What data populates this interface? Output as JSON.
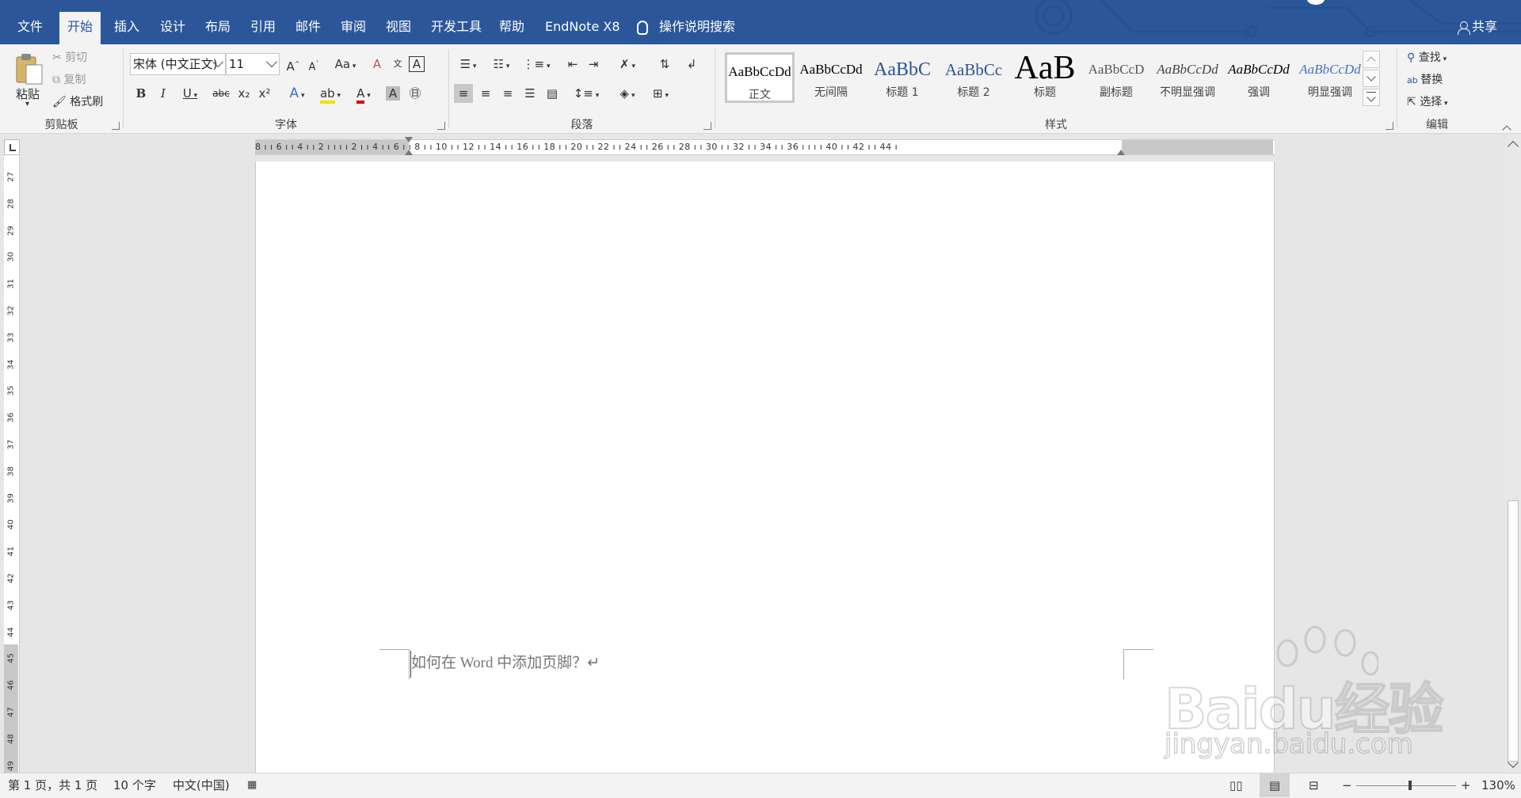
{
  "tabs": [
    "文件",
    "开始",
    "插入",
    "设计",
    "布局",
    "引用",
    "邮件",
    "审阅",
    "视图",
    "开发工具",
    "帮助",
    "EndNote X8"
  ],
  "active_tab": "开始",
  "tellme": "操作说明搜索",
  "share": "共享",
  "clipboard": {
    "paste": "粘贴",
    "cut": "剪切",
    "copy": "复制",
    "format_painter": "格式刷",
    "label": "剪贴板"
  },
  "font": {
    "name": "宋体 (中文正文)",
    "size": "11",
    "label": "字体",
    "grow": "A",
    "shrink": "A",
    "case": "Aa",
    "bold": "B",
    "italic": "I",
    "underline": "U",
    "strike": "abc",
    "sub": "x₂",
    "sup": "x²"
  },
  "paragraph": {
    "label": "段落"
  },
  "styles": {
    "label": "样式",
    "items": [
      {
        "preview": "AaBbCcDd",
        "name": "正文",
        "selected": true
      },
      {
        "preview": "AaBbCcDd",
        "name": "无间隔"
      },
      {
        "preview": "AaBbC",
        "name": "标题 1"
      },
      {
        "preview": "AaBbCc",
        "name": "标题 2"
      },
      {
        "preview": "AaB",
        "name": "标题"
      },
      {
        "preview": "AaBbCcD",
        "name": "副标题"
      },
      {
        "preview": "AaBbCcDd",
        "name": "不明显强调"
      },
      {
        "preview": "AaBbCcDd",
        "name": "强调"
      },
      {
        "preview": "AaBbCcDd",
        "name": "明显强调"
      }
    ]
  },
  "editing": {
    "find": "查找",
    "replace": "替换",
    "select": "选择",
    "label": "编辑"
  },
  "ruler": {
    "h_numbers": "8 ı  ı 6 ı  ı 4 ı  ı 2 ı  ı    ı  ı 2 ı  ı 4 ı  ı 6 ı  ı 8 ı  ı 10 ı  ı 12 ı  ı 14 ı  ı 16 ı  ı 18 ı  ı 20 ı  ı 22 ı  ı 24 ı  ı 26 ı  ı 28 ı  ı 30 ı  ı 32 ı  ı 34 ı  ı 36 ı  ı    ı  ı 40 ı  ı 42 ı  ı 44 ı",
    "v_numbers": [
      "27",
      "28",
      "29",
      "30",
      "31",
      "32",
      "33",
      "34",
      "35",
      "36",
      "37",
      "38",
      "39",
      "40",
      "41",
      "42",
      "43",
      "44",
      "45",
      "46",
      "47",
      "48",
      "49"
    ]
  },
  "document": {
    "footer_text": "如何在 Word 中添加页脚？↵"
  },
  "status": {
    "page": "第 1 页，共 1 页",
    "words": "10 个字",
    "language": "中文(中国)",
    "zoom": "130%"
  },
  "watermark": {
    "brand": "Baidu经验",
    "domain": "jingyan.baidu.com"
  }
}
